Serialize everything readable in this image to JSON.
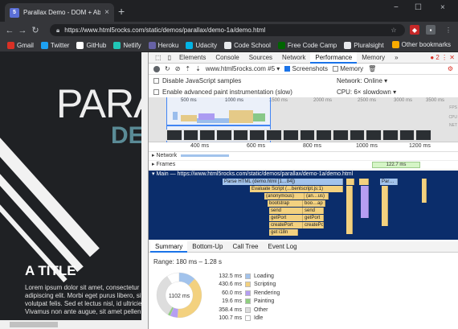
{
  "browser": {
    "tab_title": "Parallax Demo - DOM + Absolute",
    "tab_close": "×",
    "new_tab": "+",
    "url": "https://www.html5rocks.com/static/demos/parallax/demo-1a/demo.html",
    "window_controls": [
      "−",
      "☐",
      "×"
    ]
  },
  "bookmarks": [
    {
      "label": "Gmail",
      "color": "#d93025"
    },
    {
      "label": "Twitter",
      "color": "#1da1f2"
    },
    {
      "label": "GitHub",
      "color": "#ffffff"
    },
    {
      "label": "Netlify",
      "color": "#20c6b7"
    },
    {
      "label": "Heroku",
      "color": "#6762a6"
    },
    {
      "label": "Udacity",
      "color": "#02b3e4"
    },
    {
      "label": "Code School",
      "color": "#e8eaed"
    },
    {
      "label": "Free Code Camp",
      "color": "#006400"
    },
    {
      "label": "Pluralsight",
      "color": "#e8eaed"
    }
  ],
  "bookmarks_other": "Other bookmarks",
  "page": {
    "heading": "PARA",
    "subheading": "DE",
    "title": "A TITLE",
    "lorem": "Lorem ipsum dolor sit amet, consectetur adipiscing elit. Morbi eget purus libero, sit a volutpat felis. Sed et lectus nisl, id ultricie Vivamus non ante augue, sit amet pellen"
  },
  "devtools": {
    "tabs": [
      "Elements",
      "Console",
      "Sources",
      "Network",
      "Performance",
      "Memory",
      "»"
    ],
    "active_tab": "Performance",
    "error_count": "2",
    "toolbar": {
      "profile": "www.html5rocks.com #5",
      "screenshots": "Screenshots",
      "memory": "Memory"
    },
    "options": {
      "disable_js_samples": "Disable JavaScript samples",
      "advanced_paint": "Enable advanced paint instrumentation (slow)",
      "network_label": "Network:",
      "network_value": "Online",
      "cpu_label": "CPU:",
      "cpu_value": "6× slowdown"
    },
    "overview_ticks": [
      "500 ms",
      "1000 ms",
      "1500 ms",
      "2000 ms",
      "2500 ms",
      "3000 ms",
      "3500 ms"
    ],
    "overview_labels": [
      "FPS",
      "CPU",
      "NET"
    ],
    "timeline_ticks": [
      "400 ms",
      "600 ms",
      "800 ms",
      "1000 ms",
      "1200 ms"
    ],
    "network_track": "Network",
    "frames_track": "Frames",
    "frame_duration": "122.7 ms",
    "main_track": "Main — https://www.html5rocks.com/static/demos/parallax/demo-1a/demo.html",
    "flame": {
      "parse_html": "Parse HTML (demo.html [1…84])",
      "parse_right": "Par…",
      "evaluate_script": "Evaluate Script (…bentscript.js:1)",
      "anonymous_1": "(anonymous)",
      "anonymous_2": "(an…us)",
      "bootstrap": "bootstrap",
      "boot_ap": "boo…ap",
      "send_1": "send",
      "send_2": "send",
      "getport_1": "getPort",
      "getport_2": "getPort",
      "createport_1": "createPort",
      "createport_2": "createPort",
      "get18n": "get i18n"
    },
    "summary_tabs": [
      "Summary",
      "Bottom-Up",
      "Call Tree",
      "Event Log"
    ],
    "range": "Range: 180 ms – 1.28 s",
    "total": "1102 ms",
    "summary": [
      {
        "value": "132.5 ms",
        "label": "Loading",
        "color": "#a2c3ec",
        "ms": 132.5
      },
      {
        "value": "430.6 ms",
        "label": "Scripting",
        "color": "#f3d17f",
        "ms": 430.6
      },
      {
        "value": "60.0 ms",
        "label": "Rendering",
        "color": "#b59ef2",
        "ms": 60.0
      },
      {
        "value": "19.6 ms",
        "label": "Painting",
        "color": "#8fcf7f",
        "ms": 19.6
      },
      {
        "value": "358.4 ms",
        "label": "Other",
        "color": "#dddddd",
        "ms": 358.4
      },
      {
        "value": "100.7 ms",
        "label": "Idle",
        "color": "#ffffff",
        "ms": 100.7
      }
    ]
  }
}
